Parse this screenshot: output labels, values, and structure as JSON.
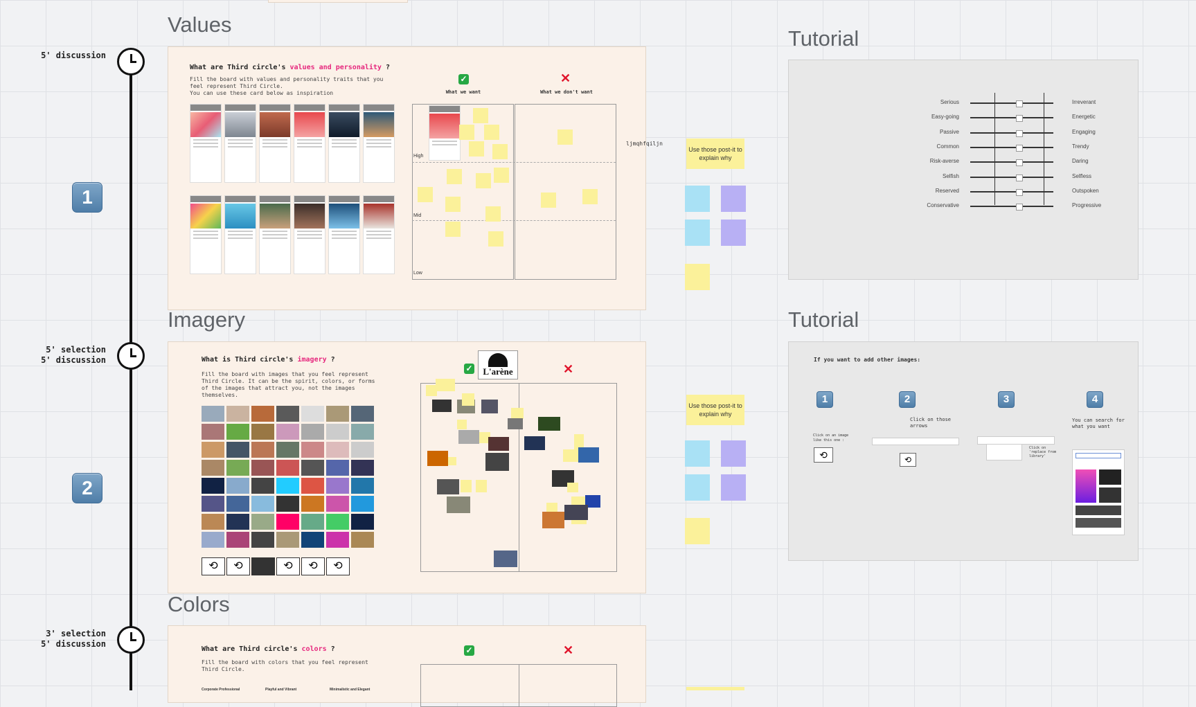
{
  "sections": {
    "values": {
      "title": "Values"
    },
    "imagery": {
      "title": "Imagery"
    },
    "colors": {
      "title": "Colors"
    },
    "tutorial1": {
      "title": "Tutorial"
    },
    "tutorial2": {
      "title": "Tutorial"
    }
  },
  "timeline": [
    {
      "duration": "5' discussion",
      "step": "1"
    },
    {
      "duration": "5' selection\n5' discussion",
      "step": "2"
    },
    {
      "duration": "3' selection\n5' discussion"
    }
  ],
  "values_board": {
    "question_prefix": "What are Third circle's ",
    "question_highlight": "values and personality",
    "question_suffix": " ?",
    "description": "Fill the board with values and personality traits that you feel represent Third Circle.\nYou can use these card below as inspiration",
    "want_label": "What we want",
    "dont_want_label": "What we don't want",
    "levels": [
      "High",
      "Mid",
      "Low"
    ],
    "stray_text": "ljmqhfqiljn"
  },
  "imagery_board": {
    "question_prefix": "What is Third circle's ",
    "question_highlight": "imagery",
    "question_suffix": " ?",
    "description": "Fill the board with images that you feel represent Third Circle.\nIt can be the spirit, colors, or forms of the images that attract you, not the images themselves.",
    "logo_text": "L'arène"
  },
  "colors_board": {
    "question_prefix": "What are Third circle's ",
    "question_highlight": "colors",
    "question_suffix": " ?",
    "description": "Fill the board with colors that you feel represent Third Circle.",
    "palettes": [
      "Corporate Professional",
      "Playful and Vibrant",
      "Minimalistic and Elegant"
    ]
  },
  "postits": {
    "label_1": "Use those post-it to explain why",
    "label_2": "Use those post-it to explain why"
  },
  "tutorial_sliders": [
    {
      "left": "Serious",
      "right": "Irreverant"
    },
    {
      "left": "Easy-going",
      "right": "Energetic"
    },
    {
      "left": "Passive",
      "right": "Engaging"
    },
    {
      "left": "Common",
      "right": "Trendy"
    },
    {
      "left": "Risk-averse",
      "right": "Daring"
    },
    {
      "left": "Selfish",
      "right": "Selfless"
    },
    {
      "left": "Reserved",
      "right": "Outspoken"
    },
    {
      "left": "Conservative",
      "right": "Progressive"
    }
  ],
  "tutorial_images": {
    "heading": "If you want to add other images:",
    "steps": [
      {
        "num": "1",
        "text": "Click on an image like this one :"
      },
      {
        "num": "2",
        "text": "Click on those arrows"
      },
      {
        "num": "3",
        "text": "Click on 'replace from library'"
      },
      {
        "num": "4",
        "text": "You can search for what you want"
      }
    ]
  },
  "colors_used": {
    "sticky_yellow": "#fbf19a",
    "sticky_blue": "#a9e1f5",
    "sticky_purple": "#b8b0f4",
    "accent_pink": "#e6277d",
    "frame_bg": "#fbf1e8"
  }
}
